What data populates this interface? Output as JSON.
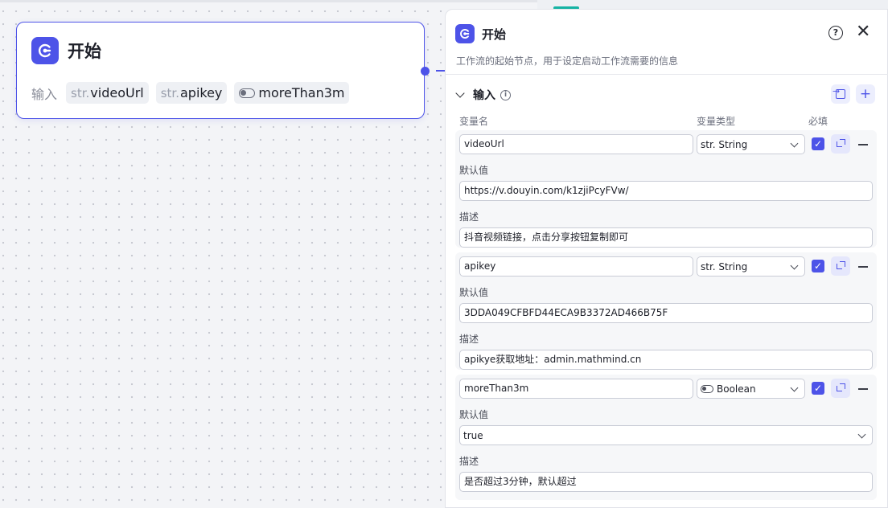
{
  "canvas_node": {
    "title": "开始",
    "inputs_label": "输入",
    "chips": [
      {
        "type_prefix": "str.",
        "name": "videoUrl"
      },
      {
        "type_prefix": "str.",
        "name": "apikey"
      },
      {
        "type_icon": "toggle-icon",
        "name": "moreThan3m"
      }
    ]
  },
  "panel": {
    "title": "开始",
    "description": "工作流的起始节点，用于设定启动工作流需要的信息",
    "section_label": "输入",
    "columns": {
      "name": "变量名",
      "type": "变量类型",
      "required": "必填"
    },
    "variables": [
      {
        "name": "videoUrl",
        "type": "str. String",
        "required": true,
        "default_label": "默认值",
        "default_value": "https://v.douyin.com/k1zjiPcyFVw/",
        "desc_label": "描述",
        "desc_value": "抖音视频链接，点击分享按钮复制即可"
      },
      {
        "name": "apikey",
        "type": "str. String",
        "required": true,
        "default_label": "默认值",
        "default_value": "3DDA049CFBFD44ECA9B3372AD466B75F",
        "desc_label": "描述",
        "desc_value": "apikye获取地址：admin.mathmind.cn"
      },
      {
        "name": "moreThan3m",
        "type": "Boolean",
        "required": true,
        "default_label": "默认值",
        "default_value": "true",
        "desc_label": "描述",
        "desc_value": "是否超过3分钟，默认超过"
      }
    ]
  },
  "colors": {
    "accent": "#4d53e8",
    "accent_light": "#eceefd",
    "teal": "#16b3a4"
  }
}
